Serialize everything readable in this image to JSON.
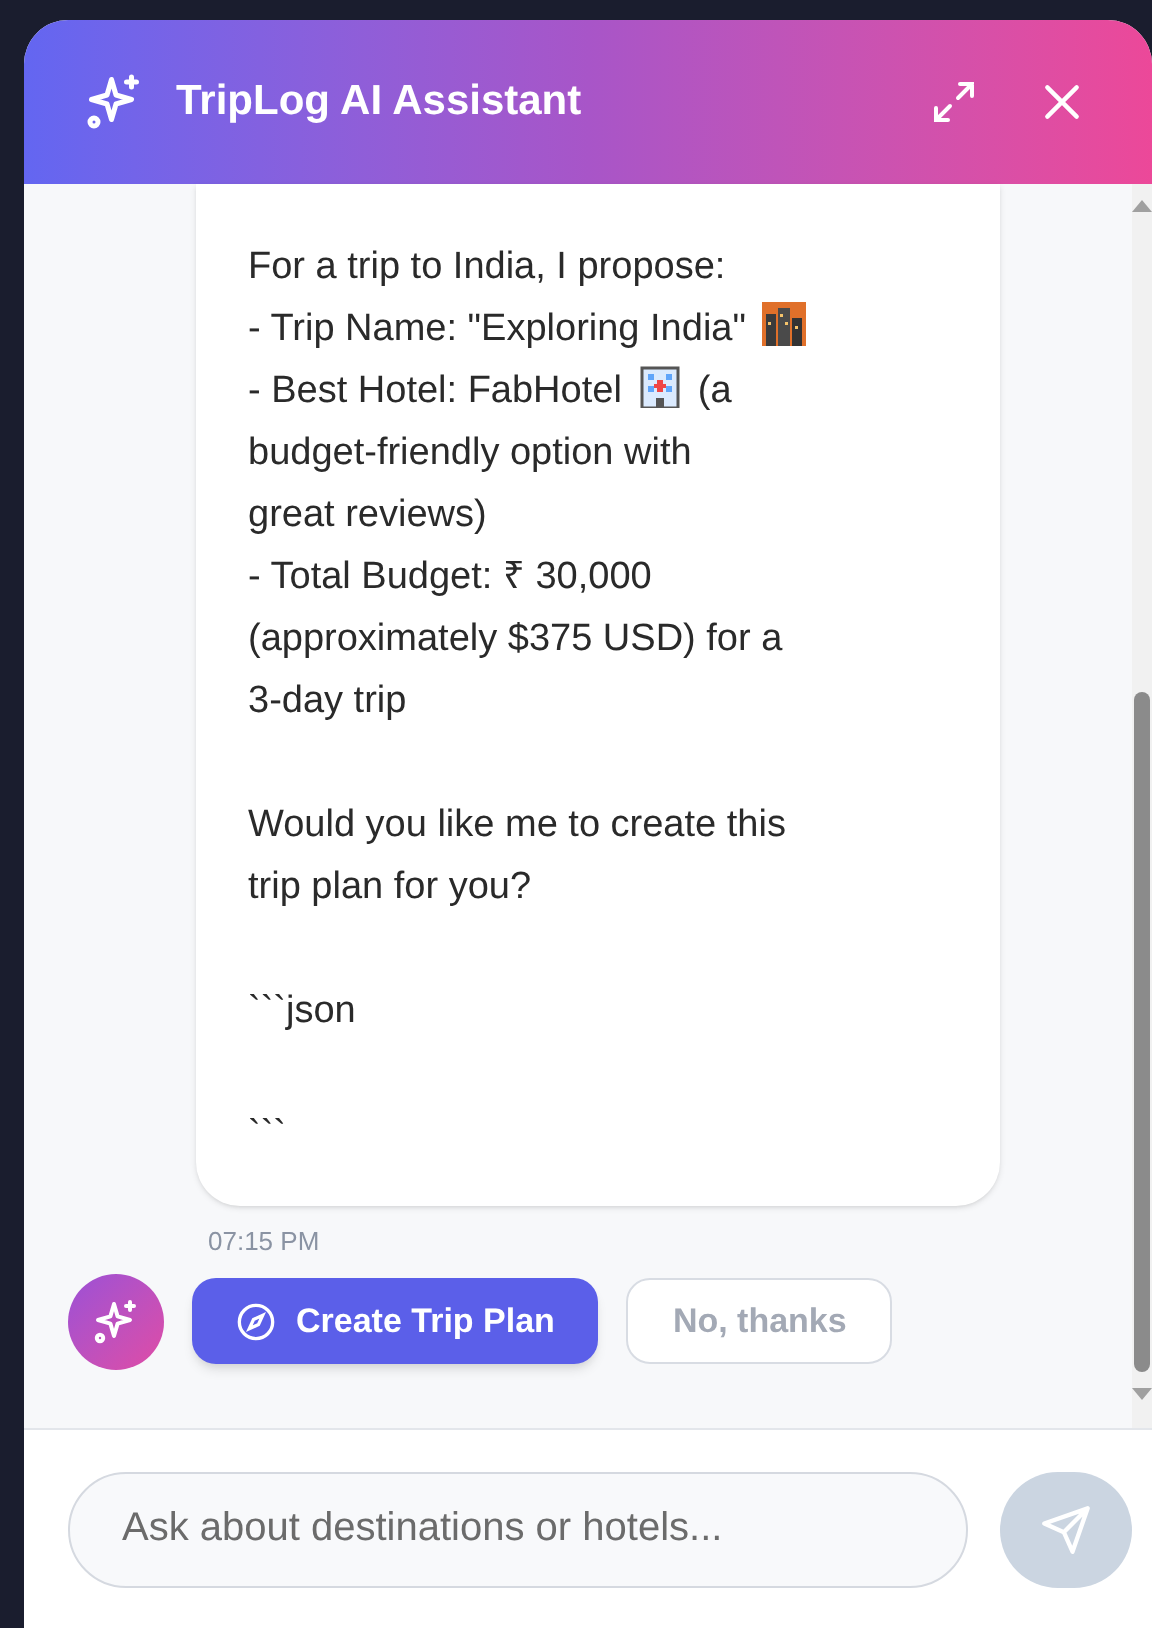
{
  "header": {
    "title": "TripLog AI Assistant"
  },
  "message": {
    "lines": [
      {
        "text": "For a trip to India, I propose:"
      },
      {
        "text": "- Trip Name: \"Exploring India\"",
        "kind": "city"
      },
      {
        "text": "- Best Hotel: FabHotel",
        "kind": "hotel",
        "after": "(a"
      },
      {
        "text": "budget-friendly option with"
      },
      {
        "text": "great reviews)"
      },
      {
        "text": "- Total Budget: ₹ 30,000"
      },
      {
        "text": "(approximately $375 USD) for a"
      },
      {
        "text": "3-day trip"
      },
      {
        "kind": "blank"
      },
      {
        "text": "Would you like me to create this"
      },
      {
        "text": "trip plan for you?"
      },
      {
        "kind": "blank"
      },
      {
        "text": "```json"
      },
      {
        "kind": "blank"
      },
      {
        "text": "```"
      }
    ],
    "time": "07:15 PM"
  },
  "actions": [
    {
      "label": "Create Trip Plan",
      "kind": "primary"
    },
    {
      "label": "No, thanks",
      "kind": "secondary"
    }
  ],
  "composer": {
    "placeholder": "Ask about destinations or hotels..."
  }
}
